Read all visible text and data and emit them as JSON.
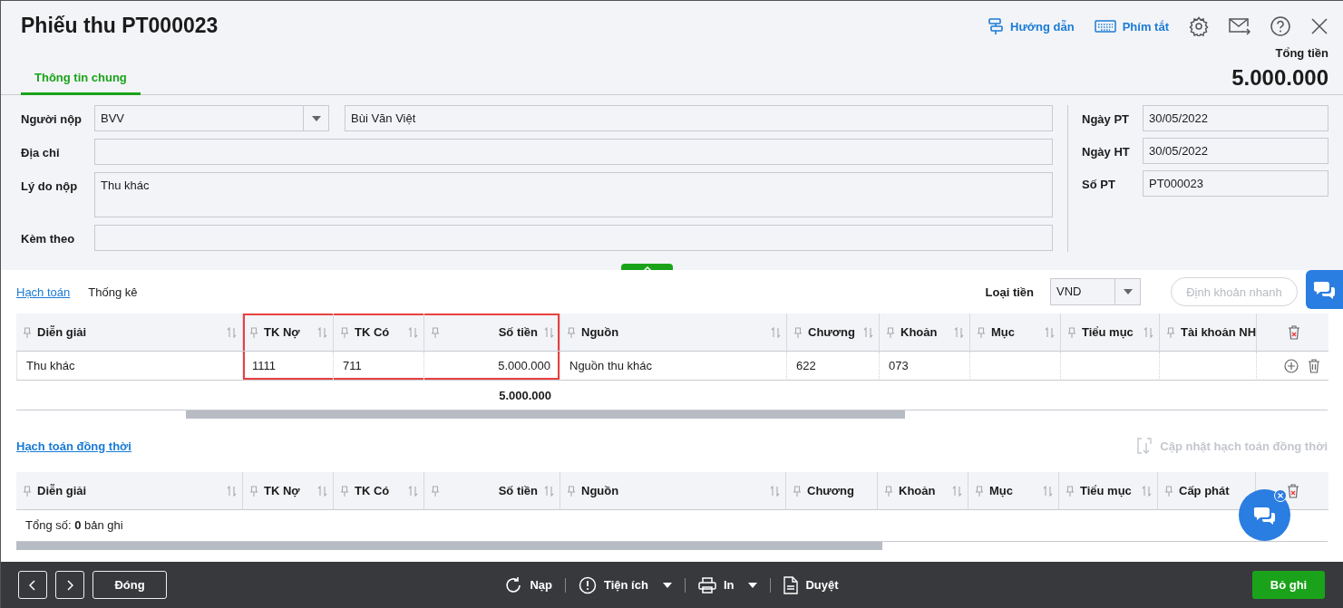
{
  "header": {
    "title": "Phiếu thu PT000023",
    "links": [
      {
        "kind": "guide",
        "label": "Hướng dẫn"
      },
      {
        "kind": "keyboard",
        "label": "Phím tắt"
      }
    ],
    "total_label": "Tổng tiền",
    "total": "5.000.000"
  },
  "tabs": [
    {
      "label": "Thông tin chung",
      "selected": true
    }
  ],
  "form": {
    "left": [
      {
        "label": "Người nộp",
        "kind": "combo",
        "value": "BVV",
        "extra": "Bùi Văn Việt"
      },
      {
        "label": "Địa chỉ",
        "kind": "text"
      },
      {
        "label": "Lý do nộp",
        "kind": "textarea",
        "value": "Thu khác"
      },
      {
        "label": "Kèm theo",
        "kind": "text"
      }
    ],
    "right": [
      {
        "label": "Ngày PT",
        "value": "30/05/2022"
      },
      {
        "label": "Ngày HT",
        "value": "30/05/2022"
      },
      {
        "label": "Số PT",
        "value": "PT000023"
      }
    ]
  },
  "detail_tabs": [
    {
      "label": "Hạch toán",
      "selected": true
    },
    {
      "label": "Thống kê",
      "selected": false
    }
  ],
  "currency": {
    "label": "Loại tiền",
    "value": "VND"
  },
  "quick_entry": {
    "label": "Định khoản nhanh",
    "disabled": true
  },
  "grid": {
    "columns": [
      {
        "label": "Diễn giải",
        "kind": "text",
        "sortable": true,
        "highlighted": false
      },
      {
        "label": "TK Nợ",
        "kind": "text",
        "sortable": true,
        "highlighted": true
      },
      {
        "label": "TK Có",
        "kind": "text",
        "sortable": true,
        "highlighted": true
      },
      {
        "label": "Số tiền",
        "kind": "amount",
        "sortable": true,
        "highlighted": true,
        "total": "5.000.000"
      },
      {
        "label": "Nguồn",
        "kind": "text",
        "sortable": true,
        "highlighted": false
      },
      {
        "label": "Chương",
        "kind": "text",
        "sortable": true,
        "highlighted": false
      },
      {
        "label": "Khoản",
        "kind": "text",
        "sortable": true,
        "highlighted": false
      },
      {
        "label": "Mục",
        "kind": "text",
        "sortable": true,
        "highlighted": false
      },
      {
        "label": "Tiểu mục",
        "kind": "text",
        "sortable": true,
        "highlighted": false
      },
      {
        "label": "Tài khoản NH",
        "kind": "text",
        "sortable": false,
        "highlighted": false
      }
    ],
    "rows": [
      {
        "cells": [
          "Thu khác",
          "1111",
          "711",
          "5.000.000",
          "Nguồn thu khác",
          "622",
          "073",
          "",
          "",
          ""
        ]
      }
    ]
  },
  "sub_section": {
    "title": "Hạch toán đồng thời",
    "action": {
      "label": "Cập nhật hạch toán đồng thời",
      "disabled": true
    }
  },
  "sub_grid": {
    "columns": [
      {
        "label": "Diễn giải",
        "kind": "text",
        "sortable": true,
        "highlighted": false
      },
      {
        "label": "TK Nợ",
        "kind": "text",
        "sortable": true,
        "highlighted": false
      },
      {
        "label": "TK Có",
        "kind": "text",
        "sortable": true,
        "highlighted": false
      },
      {
        "label": "Số tiền",
        "kind": "amount",
        "sortable": true,
        "highlighted": false
      },
      {
        "label": "Nguồn",
        "kind": "text",
        "sortable": true,
        "highlighted": false
      },
      {
        "label": "Chương",
        "kind": "text",
        "sortable": false,
        "highlighted": false
      },
      {
        "label": "Khoản",
        "kind": "text",
        "sortable": true,
        "highlighted": false
      },
      {
        "label": "Mục",
        "kind": "text",
        "sortable": true,
        "highlighted": false
      },
      {
        "label": "Tiểu mục",
        "kind": "text",
        "sortable": true,
        "highlighted": false
      },
      {
        "label": "Cấp phát",
        "kind": "text",
        "sortable": false,
        "highlighted": false
      }
    ],
    "summary": "Tổng số: **0** bản ghi"
  },
  "footer": {
    "close": "Đóng",
    "actions": [
      {
        "kind": "reload",
        "label": "Nạp",
        "menu": false
      },
      {
        "kind": "info",
        "label": "Tiện ích",
        "menu": true
      },
      {
        "kind": "print",
        "label": "In",
        "menu": true
      },
      {
        "kind": "document",
        "label": "Duyệt",
        "menu": false
      }
    ],
    "save": "Bỏ ghi"
  }
}
